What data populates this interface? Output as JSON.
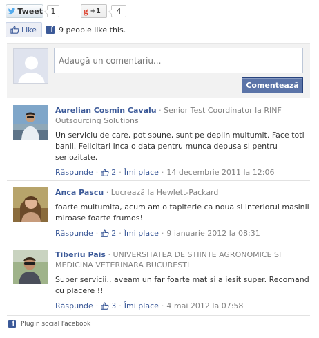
{
  "share": {
    "tweet_label": "Tweet",
    "tweet_count": "1",
    "gplus_label": "+1",
    "gplus_count": "4"
  },
  "like": {
    "label": "Like",
    "summary": "9 people like this."
  },
  "composer": {
    "placeholder": "Adaugă un comentariu...",
    "submit_label": "Comentează"
  },
  "comments": [
    {
      "author": "Aurelian Cosmin Cavalu",
      "role": "Senior Test Coordinator la RINF Outsourcing Solutions",
      "text": "Un serviciu de care, pot spune, sunt pe deplin multumit. Face toti banii. Felicitari inca o data pentru munca depusa si pentru seriozitate.",
      "reply": "Răspunde",
      "likes": "2",
      "like_action": "Îmi place",
      "date": "14 decembrie 2011 la 12:06"
    },
    {
      "author": "Anca Pascu",
      "role": "Lucrează la Hewlett-Packard",
      "text": "foarte multumita, acum am o tapiterie ca noua si interiorul masinii miroase foarte frumos!",
      "reply": "Răspunde",
      "likes": "2",
      "like_action": "Îmi place",
      "date": "9 ianuarie 2012 la 08:31"
    },
    {
      "author": "Tiberiu Pais",
      "role": "UNIVERSITATEA DE STIINTE AGRONOMICE SI MEDICINA VETERINARA BUCURESTI",
      "text": "Super servicii.. aveam un far foarte mat si a iesit super. Recomand cu placere !!",
      "reply": "Răspunde",
      "likes": "3",
      "like_action": "Îmi place",
      "date": "4 mai 2012 la 07:58"
    }
  ],
  "footer": {
    "label": "Plugin social Facebook"
  },
  "colors": {
    "facebook_blue": "#3b5998",
    "button_blue": "#5b74a8",
    "gplus_red": "#dd4b39",
    "twitter_blue": "#55acee"
  },
  "icons": {
    "tweet": "twitter-bird-icon",
    "gplus": "google-plus-icon",
    "like": "thumbs-up-icon",
    "facebook": "facebook-icon",
    "avatar_placeholder": "avatar-silhouette-icon"
  }
}
